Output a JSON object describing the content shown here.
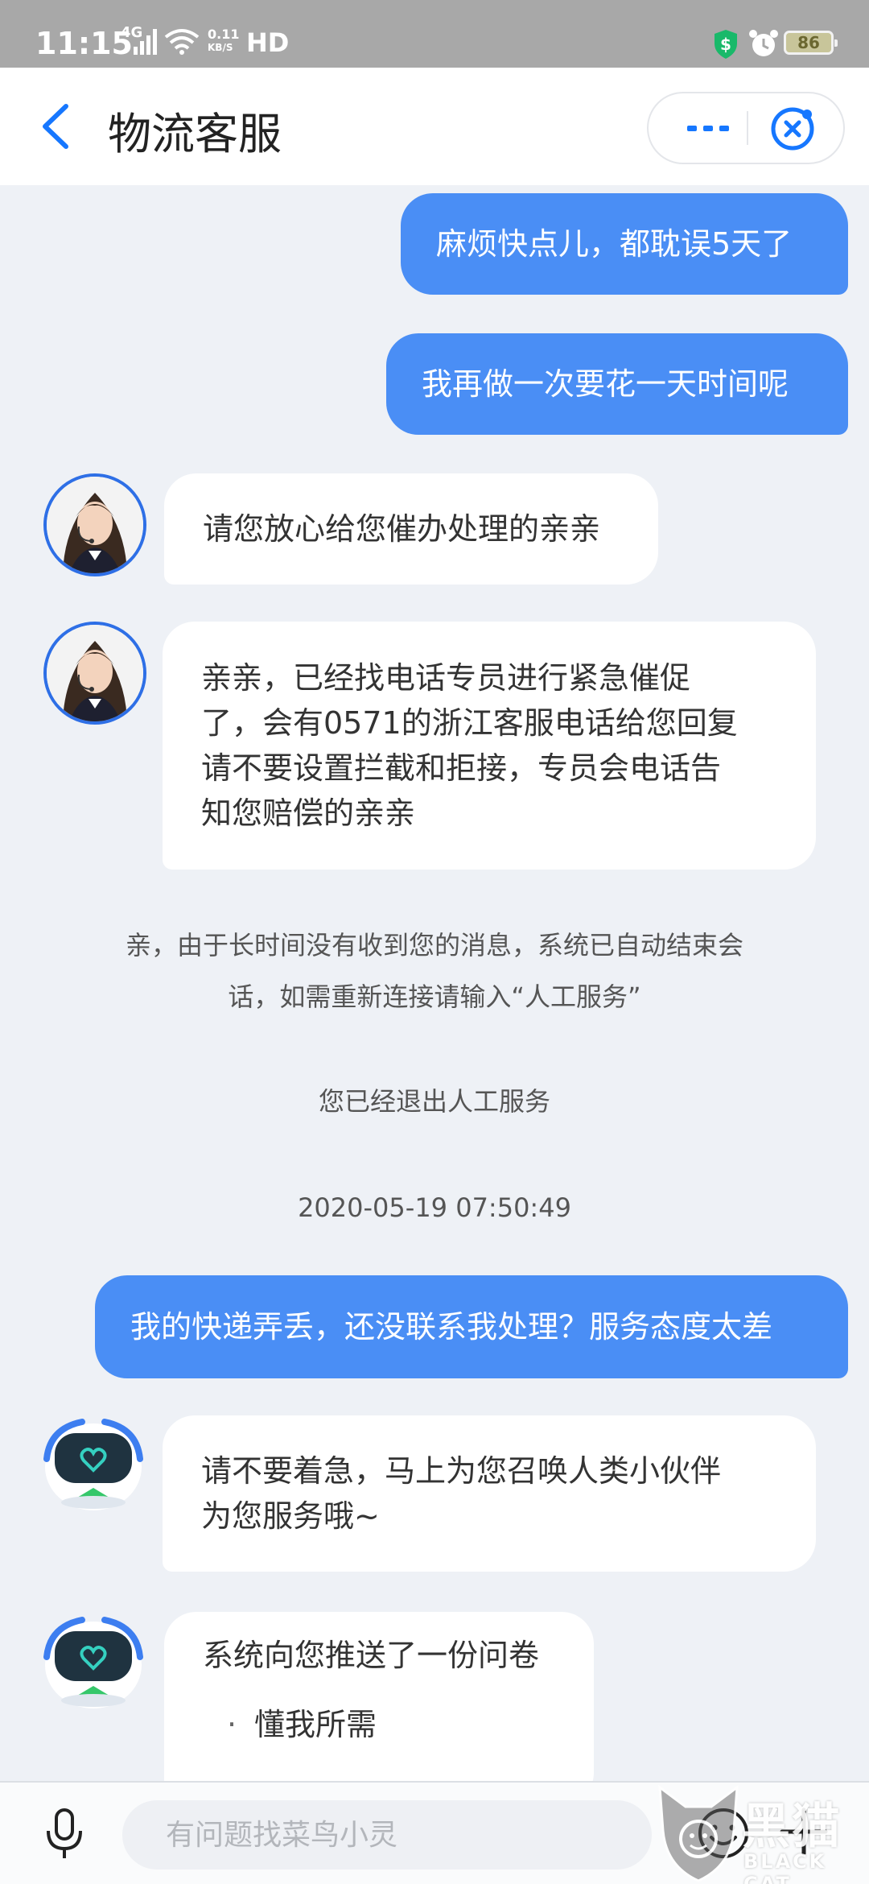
{
  "status_bar": {
    "time": "11:15",
    "network": "4G",
    "speed_value": "0.11",
    "speed_unit": "KB/S",
    "hd": "HD",
    "battery": "86"
  },
  "header": {
    "title": "物流客服",
    "back_icon": "chevron-left-icon",
    "more_icon": "more-dots-icon",
    "close_icon": "close-circle-icon"
  },
  "messages": [
    {
      "from": "user",
      "text": "麻烦快点儿，都耽误5天了"
    },
    {
      "from": "user",
      "text": "我再做一次要花一天时间呢"
    },
    {
      "from": "agent",
      "text": "请您放心给您催办处理的亲亲"
    },
    {
      "from": "agent",
      "lines": [
        "亲亲，已经找电话专员进行紧急催促",
        "了，会有0571的浙江客服电话给您回复",
        "请不要设置拦截和拒接，专员会电话告",
        "知您赔偿的亲亲"
      ]
    },
    {
      "from": "system",
      "lines": [
        "亲，由于长时间没有收到您的消息，系统已自动结束会",
        "话，如需重新连接请输入“人工服务”"
      ]
    },
    {
      "from": "system",
      "text": "您已经退出人工服务"
    },
    {
      "from": "system",
      "text": "2020-05-19 07:50:49"
    },
    {
      "from": "user",
      "text": "我的快递弄丢，还没联系我处理？服务态度太差"
    },
    {
      "from": "bot",
      "lines": [
        "请不要着急，马上为您召唤人类小伙伴",
        "为您服务哦~"
      ]
    },
    {
      "from": "bot",
      "survey_title": "系统向您推送了一份问卷",
      "survey_option": "懂我所需"
    }
  ],
  "input_bar": {
    "placeholder": "有问题找菜鸟小灵",
    "mic_icon": "microphone-icon",
    "emoji_icon": "emoji-icon",
    "plus_icon": "plus-icon"
  },
  "watermark": {
    "cn": "黑猫",
    "en": "BLACK CAT"
  },
  "colors": {
    "accent": "#1677ff",
    "outgoing_bubble": "#4a8ef5",
    "chat_background": "#eef1f6"
  }
}
